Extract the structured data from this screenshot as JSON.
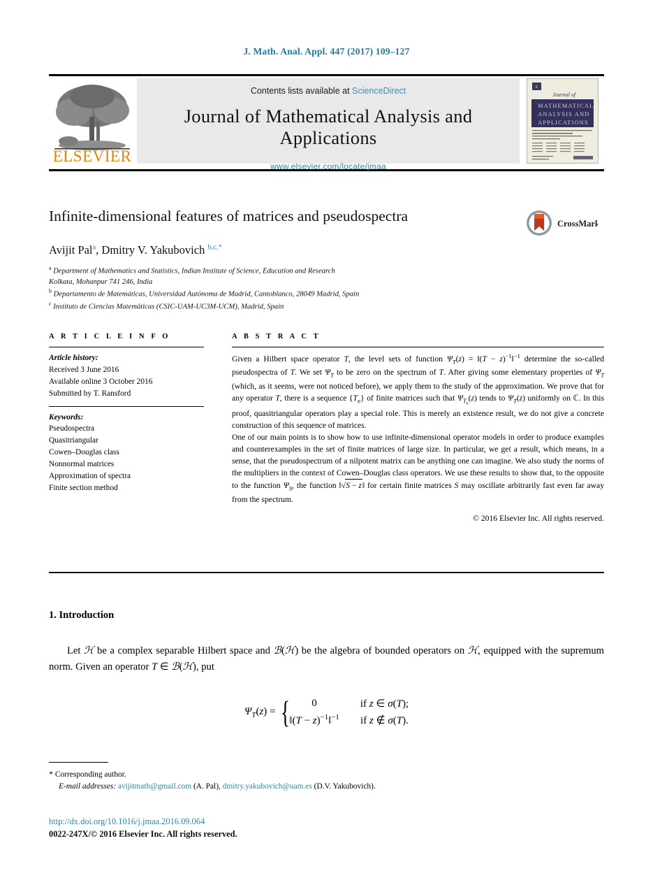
{
  "running_head": "J. Math. Anal. Appl. 447 (2017) 109–127",
  "masthead": {
    "contents_prefix": "Contents lists available at",
    "sciencedirect": "ScienceDirect",
    "journal_title": "Journal of Mathematical Analysis and Applications",
    "journal_url": "www.elsevier.com/locate/jmaa",
    "publisher_logo_text": "ELSEVIER",
    "cover_lines": [
      "Journal of",
      "MATHEMATICAL",
      "ANALYSIS AND",
      "APPLICATIONS"
    ],
    "link_color": "#3a8fc4",
    "url_color": "#2b87ad",
    "banner_bg": "#e9e9e9"
  },
  "article": {
    "title": "Infinite-dimensional features of matrices and pseudospectra",
    "crossmark_label": "CrossMark",
    "authors_plain": "Avijit Pal",
    "author1": "Avijit Pal",
    "author1_sup": "a",
    "author2": "Dmitry V. Yakubovich",
    "author2_sup": "b,c,*",
    "affiliations": [
      {
        "sup": "a",
        "text": "Department of Mathematics and Statistics, Indian Institute of Science, Education and Research"
      },
      {
        "sup": "",
        "text": "Kolkata, Mohanpur 741 246, India"
      },
      {
        "sup": "b",
        "text": "Departamento de Matemáticas, Universidad Autónoma de Madrid, Cantoblanco, 28049 Madrid, Spain"
      },
      {
        "sup": "c",
        "text": "Instituto de Ciencias Matemáticas (CSIC-UAM-UC3M-UCM), Madrid, Spain"
      }
    ]
  },
  "info": {
    "heading": "A R T I C L E    I N F O",
    "history_label": "Article history:",
    "history": [
      "Received 3 June 2016",
      "Available online 3 October 2016",
      "Submitted by T. Ransford"
    ],
    "keywords_label": "Keywords:",
    "keywords": [
      "Pseudospectra",
      "Quasitriangular",
      "Cowen–Douglas class",
      "Nonnormal matrices",
      "Approximation of spectra",
      "Finite section method"
    ]
  },
  "abstract": {
    "heading": "A B S T R A C T",
    "para1_a": "Given a Hilbert space operator ",
    "para1_b": ", the level sets of function ",
    "para1_c": " determine the so-called pseudospectra of ",
    "para1_d": ". We set ",
    "para1_e": " to be zero on the spectrum of ",
    "para1_f": ". After giving some elementary properties of ",
    "para1_g": " (which, as it seems, were not noticed before), we apply them to the study of the approximation. We prove that for any operator ",
    "para1_h": ", there is a sequence ",
    "para1_i": " of finite matrices such that ",
    "para1_j": " tends to ",
    "para1_k": " uniformly on ",
    "para1_l": ". In this proof, quasitriangular operators play a special role. This is merely an existence result, we do not give a concrete construction of this sequence of matrices.",
    "para2_a": "One of our main points is to show how to use infinite-dimensional operator models in order to produce examples and counterexamples in the set of finite matrices of large size. In particular, we get a result, which means, in a sense, that the pseudospectrum of a nilpotent matrix can be anything one can imagine. We also study the norms of the multipliers in the context of Cowen–Douglas class operators. We use these results to show that, to the opposite to the function ",
    "para2_b": ", the function ",
    "para2_c": " for certain finite matrices ",
    "para2_d": " may oscillate arbitrarily fast even far away from the spectrum.",
    "copyright": "© 2016 Elsevier Inc. All rights reserved."
  },
  "body": {
    "section1_heading": "1. Introduction",
    "para_a": "Let ",
    "para_b": " be a complex separable Hilbert space and ",
    "para_c": " be the algebra of bounded operators on ",
    "para_d": ", equipped with the supremum norm. Given an operator ",
    "para_e": ", put",
    "equation": {
      "lhs": "Ψ_T(z) =",
      "case1_value": "0",
      "case1_cond": "if z ∈ σ(T);",
      "case2_value": "‖(T − z)^−1‖^−1",
      "case2_cond": "if z ∉ σ(T)."
    }
  },
  "footnotes": {
    "corresponding": "Corresponding author.",
    "email_label": "E-mail addresses:",
    "email1": "avijitmath@gmail.com",
    "email1_owner": "(A. Pal),",
    "email2": "dmitry.yakubovich@uam.es",
    "email2_owner": "(D.V. Yakubovich).",
    "doi": "http://dx.doi.org/10.1016/j.jmaa.2016.09.064",
    "issn": "0022-247X/© 2016 Elsevier Inc. All rights reserved."
  }
}
